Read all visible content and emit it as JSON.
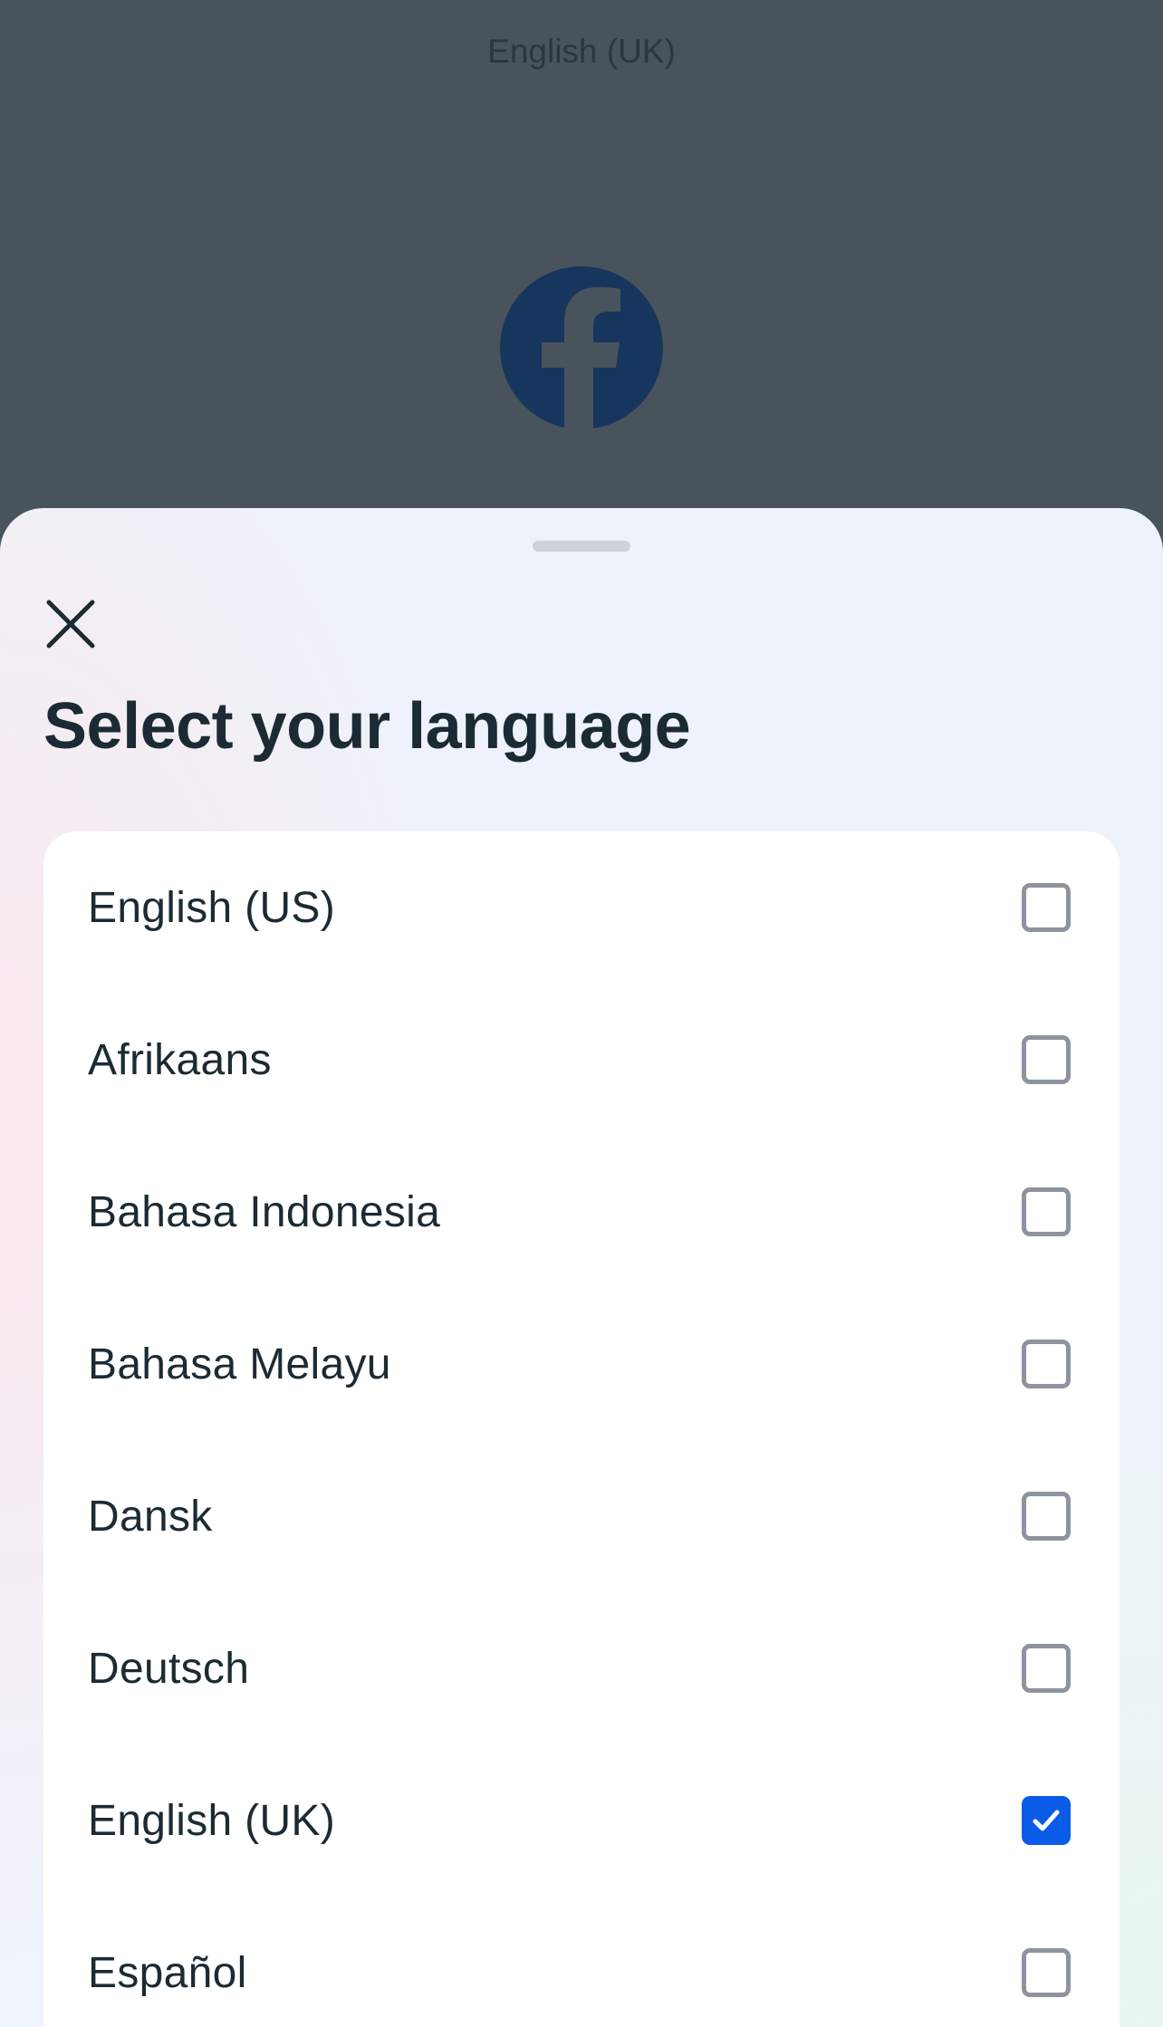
{
  "header": {
    "current_language": "English (UK)"
  },
  "sheet": {
    "title": "Select your language",
    "close_label": "Close",
    "options": [
      {
        "label": "English (US)",
        "checked": false
      },
      {
        "label": "Afrikaans",
        "checked": false
      },
      {
        "label": "Bahasa Indonesia",
        "checked": false
      },
      {
        "label": "Bahasa Melayu",
        "checked": false
      },
      {
        "label": "Dansk",
        "checked": false
      },
      {
        "label": "Deutsch",
        "checked": false
      },
      {
        "label": "English (UK)",
        "checked": true
      },
      {
        "label": "Español",
        "checked": false
      }
    ]
  },
  "colors": {
    "accent": "#0a5be8",
    "logo": "#17365e",
    "overlay": "#48535c"
  },
  "icons": {
    "logo": "facebook-logo-icon",
    "close": "close-icon",
    "check": "checkmark-icon"
  }
}
